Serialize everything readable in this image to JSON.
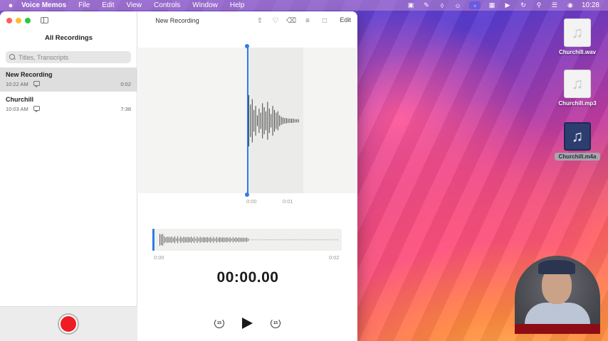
{
  "menubar": {
    "app_name": "Voice Memos",
    "items": [
      "File",
      "Edit",
      "View",
      "Controls",
      "Window",
      "Help"
    ],
    "clock": "10:28"
  },
  "sidebar": {
    "title": "All Recordings",
    "search_placeholder": "Titles, Transcripts",
    "recordings": [
      {
        "name": "New Recording",
        "date": "10:22 AM",
        "duration": "0:02",
        "selected": true
      },
      {
        "name": "Churchill",
        "date": "10:03 AM",
        "duration": "7:38",
        "selected": false
      }
    ]
  },
  "main": {
    "title": "New Recording",
    "edit_label": "Edit",
    "detail_ticks": [
      "0:00",
      "0:01"
    ],
    "overview_ticks": [
      "0:00",
      "0:02"
    ],
    "timer": "00:00.00",
    "skip_back_label": "15",
    "skip_forward_label": "15"
  },
  "desktop": {
    "files": [
      {
        "label": "Churchill.wav",
        "selected": false
      },
      {
        "label": "Churchill.mp3",
        "selected": false
      },
      {
        "label": "Churchill.m4a",
        "selected": true
      }
    ]
  },
  "colors": {
    "accent_blue": "#2f7ce6",
    "record_red": "#ee1c24"
  }
}
